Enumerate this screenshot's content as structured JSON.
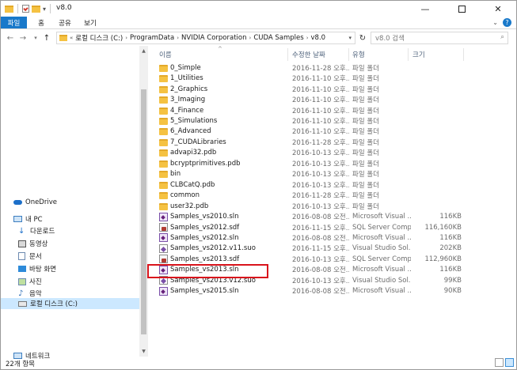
{
  "window": {
    "title": "v8.0"
  },
  "ribbon": {
    "tabs": [
      "파일",
      "홈",
      "공유",
      "보기"
    ],
    "accent": "#1979ca"
  },
  "address": {
    "prefix": "«",
    "crumbs": [
      "로컬 디스크 (C:)",
      "ProgramData",
      "NVIDIA Corporation",
      "CUDA Samples",
      "v8.0"
    ]
  },
  "search": {
    "placeholder": "v8.0 검색"
  },
  "nav": {
    "items": [
      {
        "label": "OneDrive",
        "icon": "onedrive-icon"
      },
      {
        "label": "내 PC",
        "icon": "pc-icon"
      },
      {
        "label": "다운로드",
        "icon": "download-icon"
      },
      {
        "label": "동영상",
        "icon": "video-icon"
      },
      {
        "label": "문서",
        "icon": "document-icon"
      },
      {
        "label": "바탕 화면",
        "icon": "desktop-icon"
      },
      {
        "label": "사진",
        "icon": "pictures-icon"
      },
      {
        "label": "음악",
        "icon": "music-icon"
      },
      {
        "label": "로컬 디스크 (C:)",
        "icon": "drive-icon"
      },
      {
        "label": "네트워크",
        "icon": "network-icon"
      }
    ],
    "selected": "로컬 디스크 (C:)"
  },
  "columns": {
    "name": "이름",
    "date": "수정한 날짜",
    "type": "유형",
    "size": "크기"
  },
  "files": [
    {
      "name": "0_Simple",
      "date": "2016-11-28 오후...",
      "type": "파일 폴더",
      "size": "",
      "kind": "folder"
    },
    {
      "name": "1_Utilities",
      "date": "2016-11-10 오후...",
      "type": "파일 폴더",
      "size": "",
      "kind": "folder"
    },
    {
      "name": "2_Graphics",
      "date": "2016-11-10 오후...",
      "type": "파일 폴더",
      "size": "",
      "kind": "folder"
    },
    {
      "name": "3_Imaging",
      "date": "2016-11-10 오후...",
      "type": "파일 폴더",
      "size": "",
      "kind": "folder"
    },
    {
      "name": "4_Finance",
      "date": "2016-11-10 오후...",
      "type": "파일 폴더",
      "size": "",
      "kind": "folder"
    },
    {
      "name": "5_Simulations",
      "date": "2016-11-10 오후...",
      "type": "파일 폴더",
      "size": "",
      "kind": "folder"
    },
    {
      "name": "6_Advanced",
      "date": "2016-11-10 오후...",
      "type": "파일 폴더",
      "size": "",
      "kind": "folder"
    },
    {
      "name": "7_CUDALibraries",
      "date": "2016-11-28 오후...",
      "type": "파일 폴더",
      "size": "",
      "kind": "folder"
    },
    {
      "name": "advapi32.pdb",
      "date": "2016-10-13 오후...",
      "type": "파일 폴더",
      "size": "",
      "kind": "folder"
    },
    {
      "name": "bcryptprimitives.pdb",
      "date": "2016-10-13 오후...",
      "type": "파일 폴더",
      "size": "",
      "kind": "folder"
    },
    {
      "name": "bin",
      "date": "2016-10-13 오후...",
      "type": "파일 폴더",
      "size": "",
      "kind": "folder"
    },
    {
      "name": "CLBCatQ.pdb",
      "date": "2016-10-13 오후...",
      "type": "파일 폴더",
      "size": "",
      "kind": "folder"
    },
    {
      "name": "common",
      "date": "2016-11-28 오후...",
      "type": "파일 폴더",
      "size": "",
      "kind": "folder"
    },
    {
      "name": "user32.pdb",
      "date": "2016-10-13 오후...",
      "type": "파일 폴더",
      "size": "",
      "kind": "folder"
    },
    {
      "name": "Samples_vs2010.sln",
      "date": "2016-08-08 오전...",
      "type": "Microsoft Visual ...",
      "size": "116KB",
      "kind": "sln"
    },
    {
      "name": "Samples_vs2012.sdf",
      "date": "2016-11-15 오후...",
      "type": "SQL Server Comp...",
      "size": "116,160KB",
      "kind": "sdf"
    },
    {
      "name": "Samples_vs2012.sln",
      "date": "2016-08-08 오전...",
      "type": "Microsoft Visual ...",
      "size": "116KB",
      "kind": "sln"
    },
    {
      "name": "Samples_vs2012.v11.suo",
      "date": "2016-11-15 오후...",
      "type": "Visual Studio Sol...",
      "size": "202KB",
      "kind": "suo"
    },
    {
      "name": "Samples_vs2013.sdf",
      "date": "2016-10-13 오후...",
      "type": "SQL Server Comp...",
      "size": "112,960KB",
      "kind": "sdf"
    },
    {
      "name": "Samples_vs2013.sln",
      "date": "2016-08-08 오전...",
      "type": "Microsoft Visual ...",
      "size": "116KB",
      "kind": "sln"
    },
    {
      "name": "Samples_vs2013.v12.suo",
      "date": "2016-10-13 오후...",
      "type": "Visual Studio Sol...",
      "size": "99KB",
      "kind": "suo"
    },
    {
      "name": "Samples_vs2015.sln",
      "date": "2016-08-08 오전...",
      "type": "Microsoft Visual ...",
      "size": "90KB",
      "kind": "sln"
    }
  ],
  "highlight": {
    "file": "Samples_vs2013.sln",
    "color": "#d9141c"
  },
  "status": {
    "count": "22개 항목"
  }
}
